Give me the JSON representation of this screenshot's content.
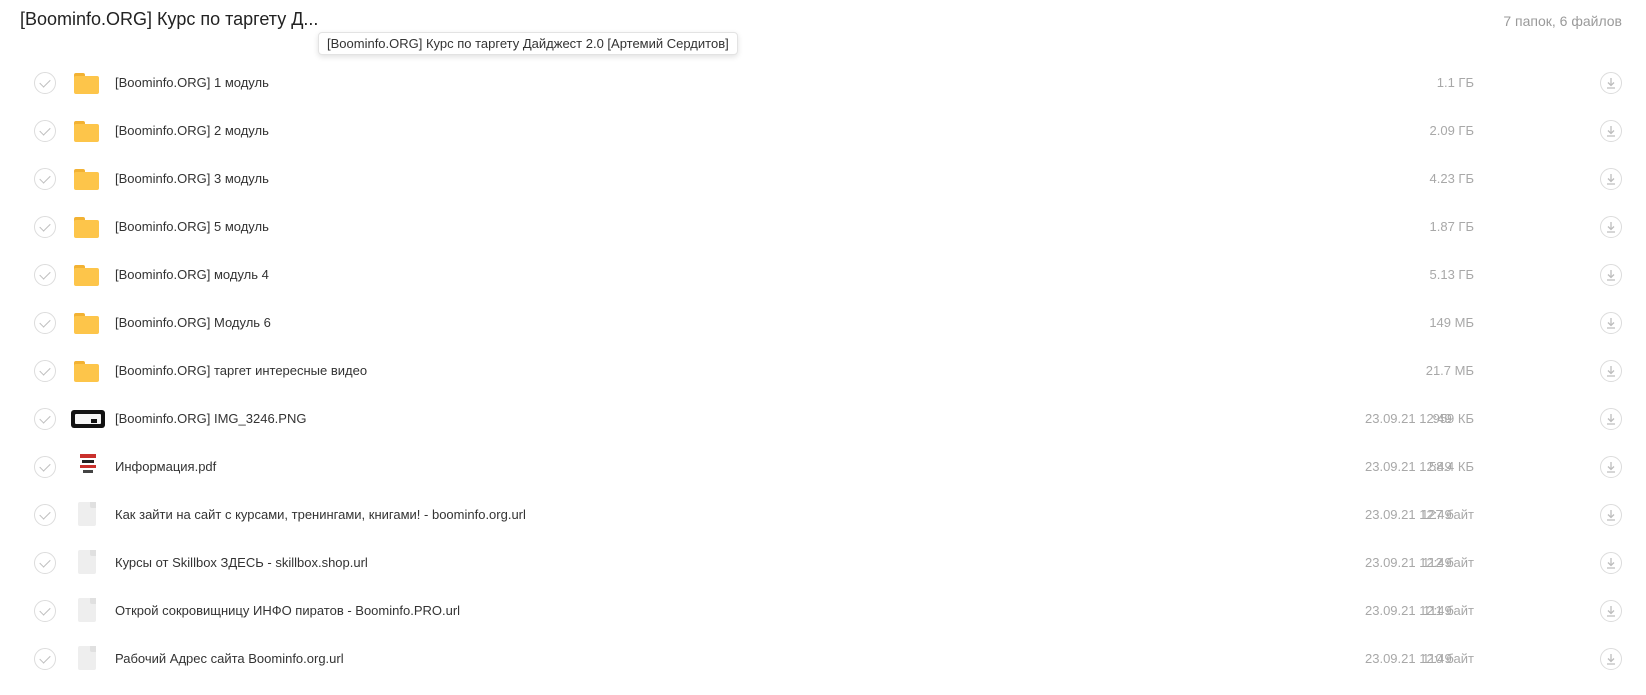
{
  "header": {
    "title": "[Boominfo.ORG] Курс по таргету Д...",
    "summary": "7 папок, 6 файлов",
    "tooltip": "[Boominfo.ORG] Курс по таргету Дайджест 2.0 [Артемий Сердитов]"
  },
  "items": [
    {
      "type": "folder",
      "icon": "folder-icon",
      "name": "[Boominfo.ORG] 1 модуль",
      "date": "",
      "size": "1.1 ГБ"
    },
    {
      "type": "folder",
      "icon": "folder-icon",
      "name": "[Boominfo.ORG] 2 модуль",
      "date": "",
      "size": "2.09 ГБ"
    },
    {
      "type": "folder",
      "icon": "folder-icon",
      "name": "[Boominfo.ORG] 3 модуль",
      "date": "",
      "size": "4.23 ГБ"
    },
    {
      "type": "folder",
      "icon": "folder-icon",
      "name": "[Boominfo.ORG] 5 модуль",
      "date": "",
      "size": "1.87 ГБ"
    },
    {
      "type": "folder",
      "icon": "folder-icon",
      "name": "[Boominfo.ORG] модуль 4",
      "date": "",
      "size": "5.13 ГБ"
    },
    {
      "type": "folder",
      "icon": "folder-icon",
      "name": "[Boominfo.ORG] Модуль 6",
      "date": "",
      "size": "149 МБ"
    },
    {
      "type": "folder",
      "icon": "folder-icon",
      "name": "[Boominfo.ORG] таргет интересные видео",
      "date": "",
      "size": "21.7 МБ"
    },
    {
      "type": "image",
      "icon": "image-thumbnail-icon",
      "name": "[Boominfo.ORG] IMG_3246.PNG",
      "date": "23.09.21 12:49",
      "size": "959 КБ"
    },
    {
      "type": "pdf",
      "icon": "pdf-thumbnail-icon",
      "name": "Информация.pdf",
      "date": "23.09.21 12:49",
      "size": "58.4 КБ"
    },
    {
      "type": "file",
      "icon": "file-icon",
      "name": "Как зайти на сайт с курсами, тренингами, книгами! - boominfo.org.url",
      "date": "23.09.21 12:49",
      "size": "127 байт"
    },
    {
      "type": "file",
      "icon": "file-icon",
      "name": "Курсы от Skillbox ЗДЕСЬ - skillbox.shop.url",
      "date": "23.09.21 12:49",
      "size": "112 байт"
    },
    {
      "type": "file",
      "icon": "file-icon",
      "name": "Открой сокровищницу ИНФО пиратов - Boominfo.PRO.url",
      "date": "23.09.21 12:49",
      "size": "111 байт"
    },
    {
      "type": "file",
      "icon": "file-icon",
      "name": "Рабочий Адрес сайта Boominfo.org.url",
      "date": "23.09.21 12:49",
      "size": "110 байт"
    }
  ],
  "colors": {
    "folder": "#fdc54a",
    "text": "#333333",
    "muted": "#a8a8a8"
  }
}
